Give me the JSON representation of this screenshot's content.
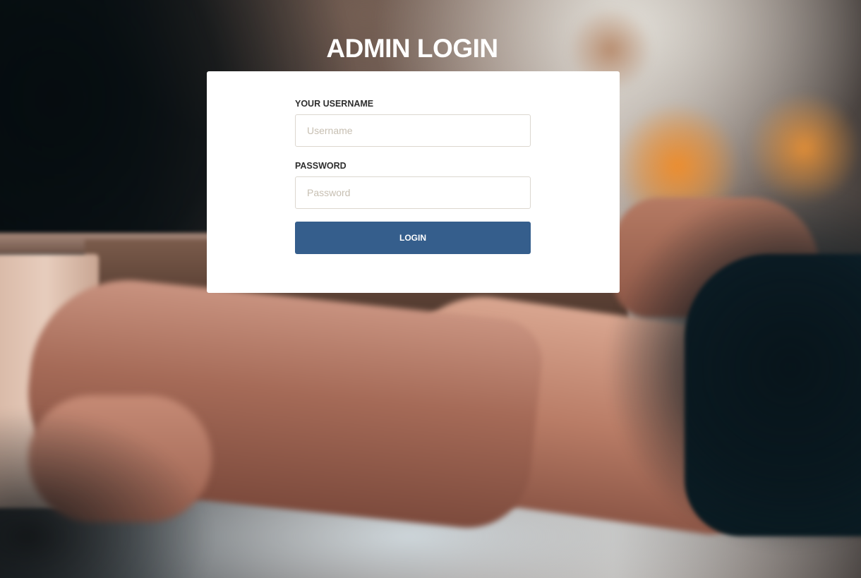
{
  "page": {
    "title": "ADMIN LOGIN"
  },
  "form": {
    "username_label": "YOUR USERNAME",
    "username_placeholder": "Username",
    "username_value": "",
    "password_label": "PASSWORD",
    "password_placeholder": "Password",
    "password_value": "",
    "login_label": "LOGIN"
  },
  "colors": {
    "button": "#355e8c",
    "card": "#ffffff",
    "title": "#ffffff",
    "input_border": "#dcd7cf"
  },
  "background": {
    "description_icon": "background-photo"
  }
}
